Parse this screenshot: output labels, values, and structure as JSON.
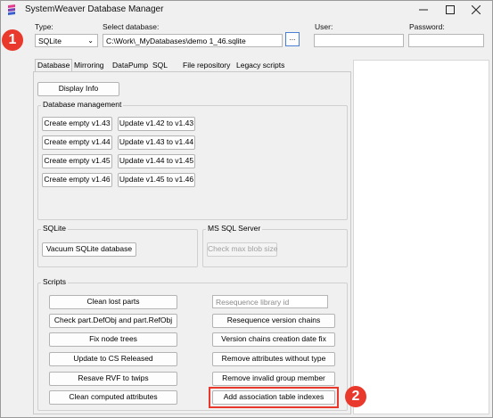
{
  "window": {
    "title": "SystemWeaver Database Manager"
  },
  "header": {
    "type_label": "Type:",
    "type_value": "SQLite",
    "select_db_label": "Select database:",
    "db_path": "C:\\Work\\_MyDatabases\\demo 1_46.sqlite",
    "browse_label": "...",
    "user_label": "User:",
    "password_label": "Password:"
  },
  "tabs": [
    "Database",
    "Mirroring",
    "DataPump",
    "SQL",
    "File repository",
    "Legacy scripts"
  ],
  "database_tab": {
    "display_info": "Display Info",
    "db_management": {
      "label": "Database management",
      "create_buttons": [
        "Create empty v1.43",
        "Create empty v1.44",
        "Create empty v1.45",
        "Create empty v1.46"
      ],
      "update_buttons": [
        "Update v1.42 to v1.43",
        "Update v1.43 to v1.44",
        "Update v1.44 to v1.45",
        "Update v1.45 to v1.46"
      ]
    },
    "sqlite": {
      "label": "SQLite",
      "vacuum": "Vacuum SQLite database"
    },
    "mssql": {
      "label": "MS SQL Server",
      "check_blob": "Check max blob size"
    },
    "scripts": {
      "label": "Scripts",
      "left_buttons": [
        "Clean lost parts",
        "Check part.DefObj and part.RefObj",
        "Fix node trees",
        "Update to CS Released",
        "Resave RVF to twips",
        "Clean computed attributes"
      ],
      "resequence_placeholder": "Resequence library id",
      "right_buttons": [
        "Resequence version chains",
        "Version chains creation date fix",
        "Remove attributes without type",
        "Remove invalid group member",
        "Add association table indexes"
      ]
    }
  },
  "annotations": {
    "step1": "1",
    "step2": "2"
  },
  "colors": {
    "annotation_red": "#e8392c",
    "window_bg": "#f0f0f0",
    "browse_border": "#4a7fd4"
  }
}
